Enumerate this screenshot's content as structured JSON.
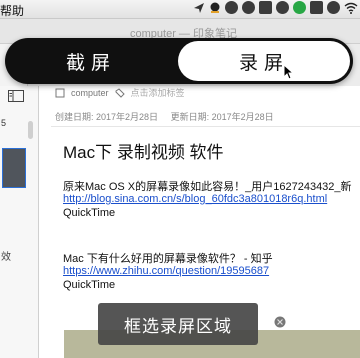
{
  "menubar": {
    "help": "帮助"
  },
  "window": {
    "title": "computer — 印象笔记"
  },
  "capture_toolbar": {
    "screenshot_label": "截屏",
    "record_label": "录屏"
  },
  "sidebar": {
    "list_count": "5",
    "truncated_text": "效"
  },
  "note": {
    "notebook": "computer",
    "add_tag_placeholder": "点击添加标签",
    "created": "创建日期: 2017年2月28日",
    "updated": "更新日期: 2017年2月28日",
    "title": "Mac下 录制视频 软件",
    "p1": "原来Mac OS X的屏幕录像如此容易！_用户1627243432_新",
    "link1": "http://blog.sina.com.cn/s/blog_60fdc3a801018r6q.html",
    "app1": "QuickTime",
    "p2": "Mac 下有什么好用的屏幕录像软件？ - 知乎",
    "link2": "https://www.zhihu.com/question/19595687",
    "app2": "QuickTime"
  },
  "region_toast": "框选录屏区域"
}
